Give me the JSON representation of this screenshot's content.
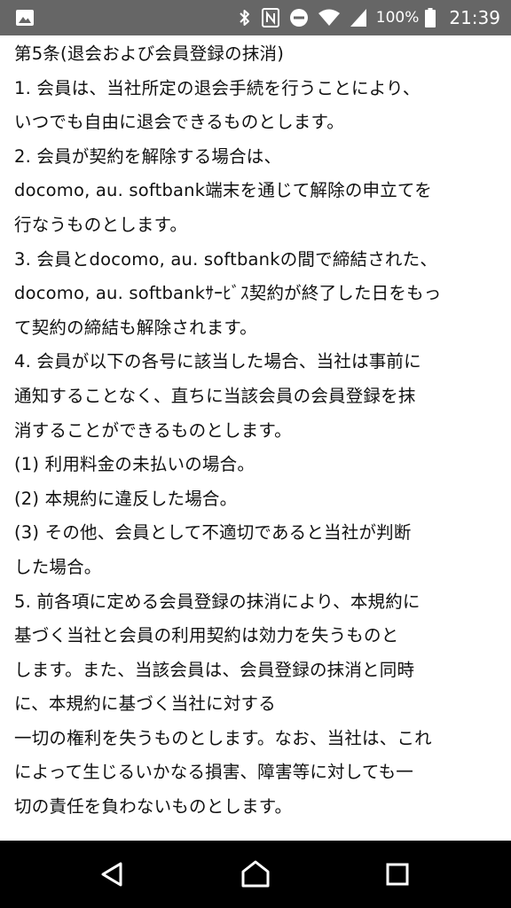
{
  "status_bar": {
    "battery_percent": "100%",
    "time": "21:39",
    "icons": [
      "image-icon",
      "bluetooth-icon",
      "nfc-icon",
      "do-not-disturb-icon",
      "wifi-icon",
      "cellular-signal-icon",
      "battery-icon"
    ]
  },
  "article": {
    "lines": [
      "第5条(退会および会員登録の抹消)",
      "1. 会員は、当社所定の退会手続を行うことにより、",
      "いつでも自由に退会できるものとします。",
      "2. 会員が契約を解除する場合は、",
      "docomo, au. softbank端末を通じて解除の申立てを",
      "行なうものとします。",
      "3. 会員とdocomo, au. softbankの間で締結された、",
      "docomo, au. softbankｻｰﾋﾞｽ契約が終了した日をもっ",
      "て契約の締結も解除されます。",
      "4. 会員が以下の各号に該当した場合、当社は事前に",
      "通知することなく、直ちに当該会員の会員登録を抹",
      "消することができるものとします。",
      "(1) 利用料金の未払いの場合。",
      "(2) 本規約に違反した場合。",
      "(3) その他、会員として不適切であると当社が判断",
      "した場合。",
      "5. 前各項に定める会員登録の抹消により、本規約に",
      "基づく当社と会員の利用契約は効力を失うものと",
      "します。また、当該会員は、会員登録の抹消と同時",
      "に、本規約に基づく当社に対する",
      "一切の権利を失うものとします。なお、当社は、これ",
      "によって生じるいかなる損害、障害等に対しても一",
      "切の責任を負わないものとします。"
    ]
  },
  "nav_bar": {
    "buttons": [
      "back-button",
      "home-button",
      "recents-button"
    ]
  }
}
